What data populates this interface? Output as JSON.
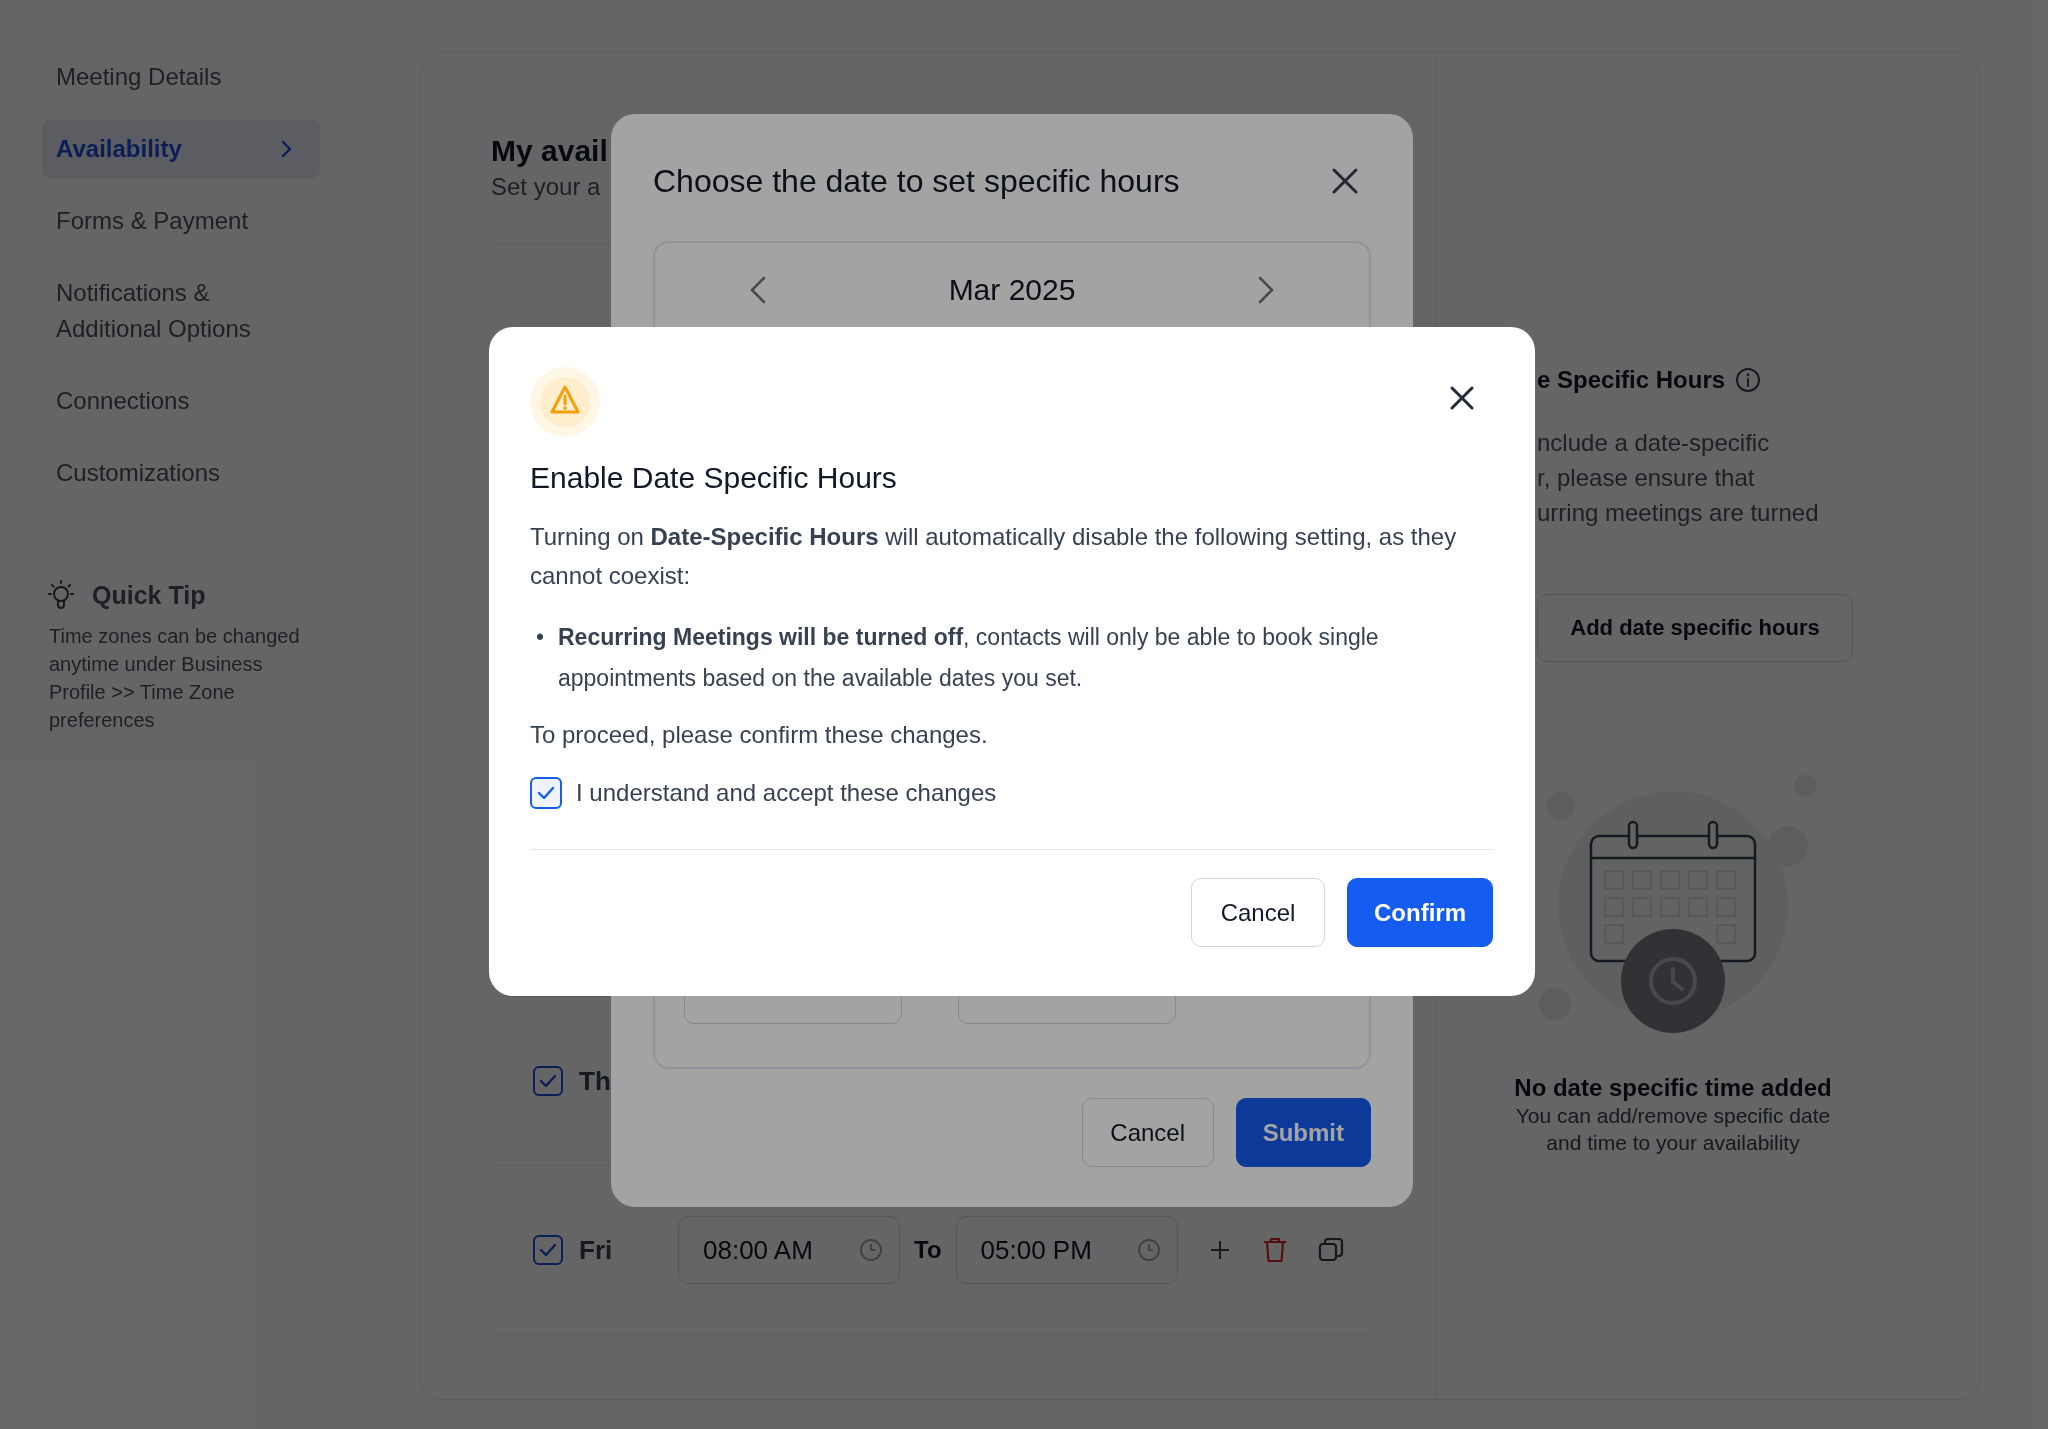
{
  "sidebar": {
    "items": [
      {
        "label": "Meeting Details",
        "selected": false
      },
      {
        "label": "Availability",
        "selected": true
      },
      {
        "label": "Forms & Payment",
        "selected": false
      },
      {
        "label": "Notifications & Additional Options",
        "selected": false
      },
      {
        "label": "Connections",
        "selected": false
      },
      {
        "label": "Customizations",
        "selected": false
      }
    ]
  },
  "quick_tip": {
    "title": "Quick Tip",
    "text": "Time zones can be changed anytime under Business Profile >> Time Zone preferences"
  },
  "availability": {
    "title": "My avail",
    "subtitle": "Set your a",
    "days": [
      {
        "label": "Th",
        "checked": true
      },
      {
        "label": "Fri",
        "checked": true,
        "slots": [
          {
            "from": "08:00 AM",
            "to_label": "To",
            "to": "05:00 PM"
          }
        ]
      }
    ]
  },
  "date_specific": {
    "title": "e Specific Hours",
    "description_lines": [
      "nclude a date-specific",
      "r, please ensure that",
      "urring meetings are turned"
    ],
    "add_button": "Add date specific hours",
    "empty_title": "No date specific time added",
    "empty_text": "You can add/remove specific date and time to your availability"
  },
  "date_dialog": {
    "title": "Choose the date to set specific hours",
    "month": "Mar 2025",
    "buttons": [
      {
        "label": "Cancel",
        "kind": "secondary"
      },
      {
        "label": "Submit",
        "kind": "primary"
      }
    ]
  },
  "confirm_dialog": {
    "title": "Enable Date Specific Hours",
    "intro": "Turning on **Date-Specific Hours** will automatically disable the following setting, as they cannot coexist:",
    "bullets": [
      {
        "marker": "•",
        "text": "**Recurring Meetings will be turned off**, contacts will only be able to book single appointments based on the available dates you set."
      }
    ],
    "prompt": "To proceed, please confirm these changes.",
    "checkbox": {
      "label": "I understand and accept these changes",
      "checked": true
    },
    "buttons": [
      {
        "label": "Cancel",
        "kind": "secondary"
      },
      {
        "label": "Confirm",
        "kind": "primary"
      }
    ]
  }
}
